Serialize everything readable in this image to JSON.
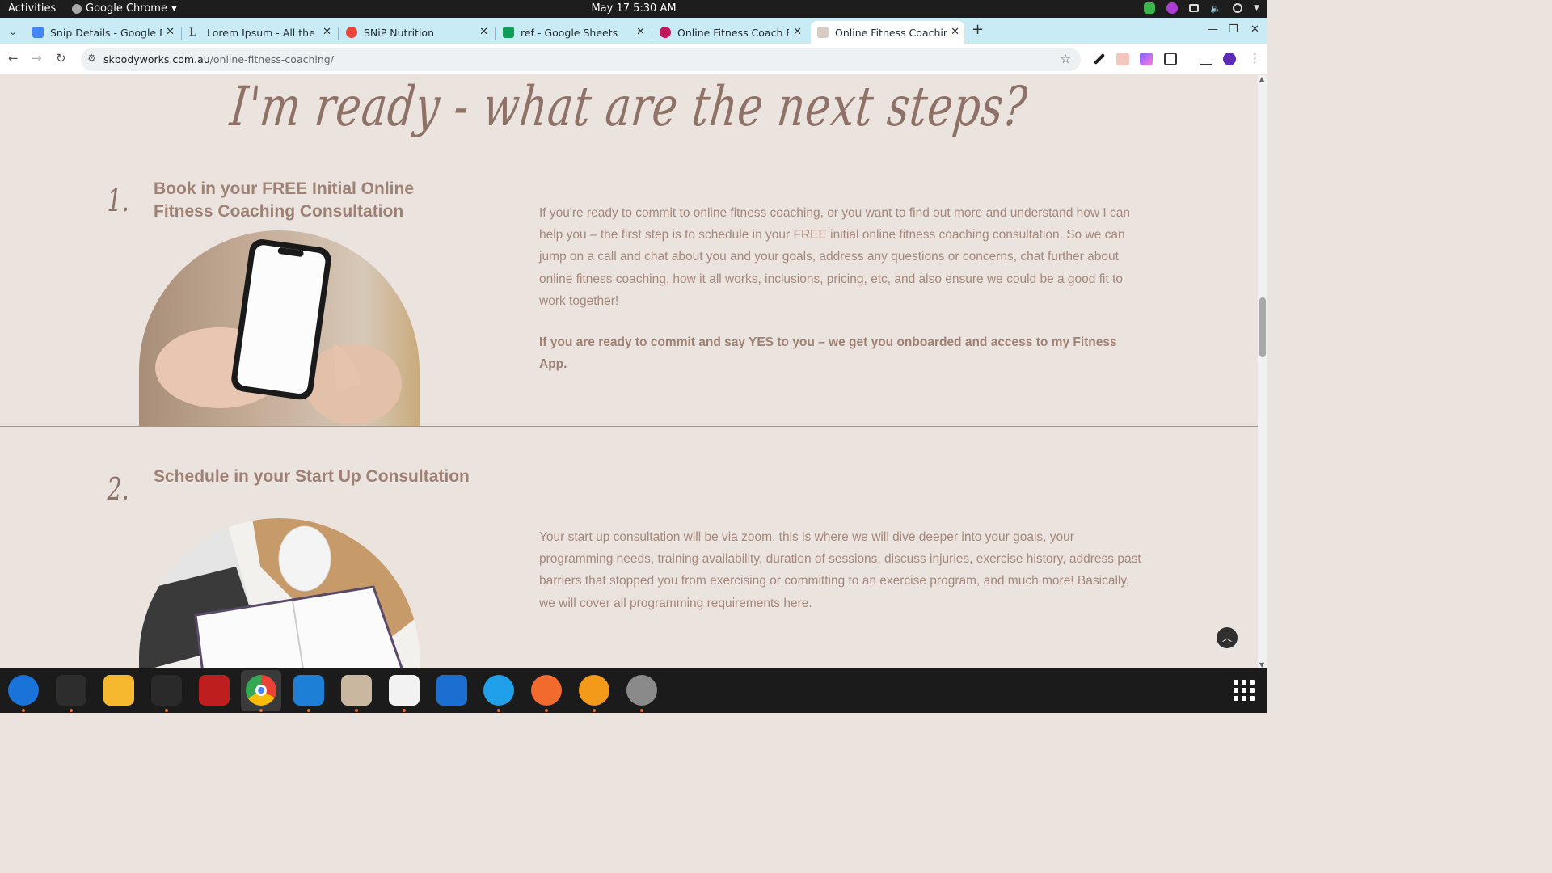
{
  "system": {
    "activities": "Activities",
    "app_name": "Google Chrome",
    "clock": "May 17  5:30 AM"
  },
  "tabs": [
    {
      "title": "Snip Details - Google Do",
      "favicon_color": "#4285f4"
    },
    {
      "title": "Lorem Ipsum - All the fac",
      "favicon_color": "#444444"
    },
    {
      "title": "SNiP Nutrition",
      "favicon_color": "#e8453c"
    },
    {
      "title": "ref - Google Sheets",
      "favicon_color": "#0f9d58"
    },
    {
      "title": "Online Fitness Coach Bri",
      "favicon_color": "#c2185b"
    },
    {
      "title": "Online Fitness Coaching",
      "favicon_color": "#c8b8b0"
    }
  ],
  "active_tab": 5,
  "address": {
    "domain": "skbodyworks.com.au",
    "path": "/online-fitness-coaching/"
  },
  "page": {
    "heading": "I'm ready - what are the next steps?",
    "steps": [
      {
        "number": "1.",
        "title": "Book in your FREE Initial Online Fitness Coaching Consultation",
        "body": "If you're ready to commit to online fitness coaching, or you want to find out more and understand how I can help you – the first step is to schedule in your FREE initial online fitness coaching consultation. So we can jump on a call and chat about you and your goals, address any questions or concerns, chat further about online fitness coaching, how it all works, inclusions, pricing, etc, and also ensure we could be a good fit to work together!",
        "emphasis": "If you are ready to commit and say YES to you – we get you onboarded and access to my Fitness App."
      },
      {
        "number": "2.",
        "title": "Schedule in your Start Up Consultation",
        "body": "Your start up consultation will be via zoom, this is where we will dive deeper into your goals, your programming needs, training availability, duration of sessions, discuss injuries, exercise history, address past barriers that stopped you from exercising or committing to an exercise program, and much more! Basically, we will cover all programming requirements here."
      }
    ]
  },
  "dock": [
    {
      "name": "thunderbird-icon",
      "color": "#1a73d9"
    },
    {
      "name": "terminal-icon",
      "color": "#2d2d2d"
    },
    {
      "name": "calculator-icon",
      "color": "#f5b82e"
    },
    {
      "name": "system-monitor-icon",
      "color": "#2a2a2a"
    },
    {
      "name": "filezilla-icon",
      "color": "#bf1e1e"
    },
    {
      "name": "chrome-icon",
      "color": "#ffffff"
    },
    {
      "name": "vscode-icon",
      "color": "#1e7fd6"
    },
    {
      "name": "files-icon",
      "color": "#c9b79f"
    },
    {
      "name": "text-editor-icon",
      "color": "#f2f2f2"
    },
    {
      "name": "document-viewer-icon",
      "color": "#1b6fd1"
    },
    {
      "name": "skype-icon",
      "color": "#1fa0e8"
    },
    {
      "name": "inkscape-icon",
      "color": "#f26a2e"
    },
    {
      "name": "hotspot-icon",
      "color": "#f49a1a"
    },
    {
      "name": "disk-icon",
      "color": "#8a8a8a"
    }
  ]
}
